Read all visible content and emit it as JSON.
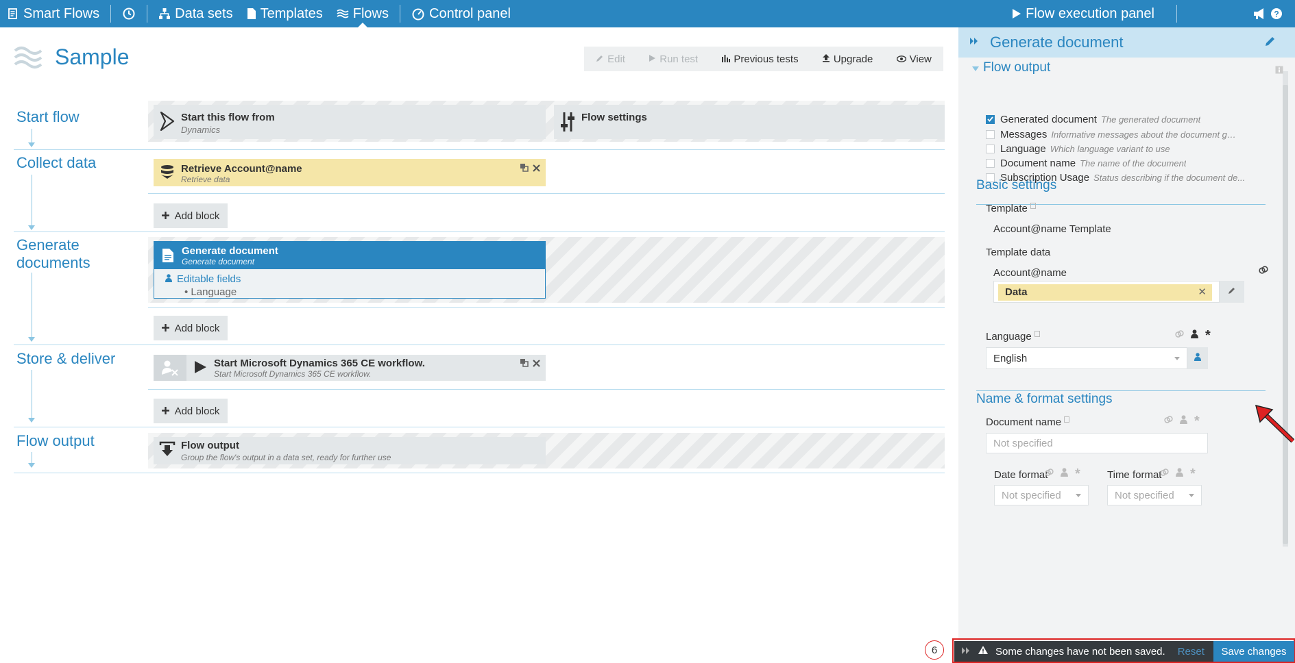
{
  "topbar": {
    "brand": "Smart Flows",
    "datasets": "Data sets",
    "templates": "Templates",
    "flows": "Flows",
    "control_panel": "Control panel",
    "flow_execution_panel": "Flow execution panel"
  },
  "page": {
    "title": "Sample"
  },
  "toolbar": {
    "edit": "Edit",
    "run_test": "Run test",
    "previous_tests": "Previous tests",
    "upgrade": "Upgrade",
    "view": "View"
  },
  "sections": {
    "start_flow": "Start flow",
    "collect_data": "Collect data",
    "generate_documents": "Generate documents",
    "store_deliver": "Store & deliver",
    "flow_output": "Flow output"
  },
  "blocks": {
    "start_from_title": "Start this flow from",
    "start_from_sub": "Dynamics",
    "flow_settings_title": "Flow settings",
    "retrieve_title": "Retrieve Account@name",
    "retrieve_sub": "Retrieve data",
    "generate_title": "Generate document",
    "generate_sub": "Generate document",
    "editable_fields": "Editable fields",
    "editable_item": "Language",
    "workflow_title": "Start Microsoft Dynamics 365 CE workflow.",
    "workflow_sub": "Start Microsoft Dynamics 365 CE workflow.",
    "output_title": "Flow output",
    "output_sub": "Group the flow's output in a data set, ready for further use",
    "add_block": "Add block"
  },
  "panel": {
    "title": "Generate document",
    "flow_output_title": "Flow output",
    "outputs": [
      {
        "label": "Generated document",
        "desc": "The generated document",
        "checked": true
      },
      {
        "label": "Messages",
        "desc": "Informative messages about the document gen...",
        "checked": false
      },
      {
        "label": "Language",
        "desc": "Which language variant to use",
        "checked": false
      },
      {
        "label": "Document name",
        "desc": "The name of the document",
        "checked": false
      },
      {
        "label": "Subscription Usage",
        "desc": "Status describing if the document de...",
        "checked": false
      }
    ],
    "basic_settings": "Basic settings",
    "template_label": "Template",
    "template_value": "Account@name Template",
    "template_data_label": "Template data",
    "account_label": "Account@name",
    "data_chip": "Data",
    "language_label": "Language",
    "language_value": "English",
    "name_format_settings": "Name & format settings",
    "document_name_label": "Document name",
    "document_name_placeholder": "Not specified",
    "date_format_label": "Date format",
    "date_format_value": "Not specified",
    "time_format_label": "Time format",
    "time_format_value": "Not specified"
  },
  "savebar": {
    "badge": "6",
    "message": "Some changes have not been saved.",
    "reset": "Reset",
    "save": "Save changes"
  },
  "colors": {
    "brand_blue": "#2a86c0",
    "panel_header": "#c9e4f3",
    "yellow_block": "#f5e6a8",
    "annotation_red": "#dd2222"
  },
  "icons": [
    "document-stack-icon",
    "clock-icon",
    "sitemap-icon",
    "file-icon",
    "waves-icon",
    "gauge-icon",
    "play-icon",
    "megaphone-icon",
    "help-icon",
    "pencil-icon",
    "play-outline-icon",
    "bar-chart-icon",
    "upload-icon",
    "eye-icon",
    "dynamics-icon",
    "sliders-icon",
    "database-icon",
    "copy-icon",
    "close-icon",
    "document-icon",
    "user-icon",
    "user-x-icon",
    "download-box-icon",
    "plus-icon",
    "double-chevron-right-icon",
    "link-icon",
    "asterisk-icon",
    "warning-icon",
    "red-arrow-icon"
  ]
}
